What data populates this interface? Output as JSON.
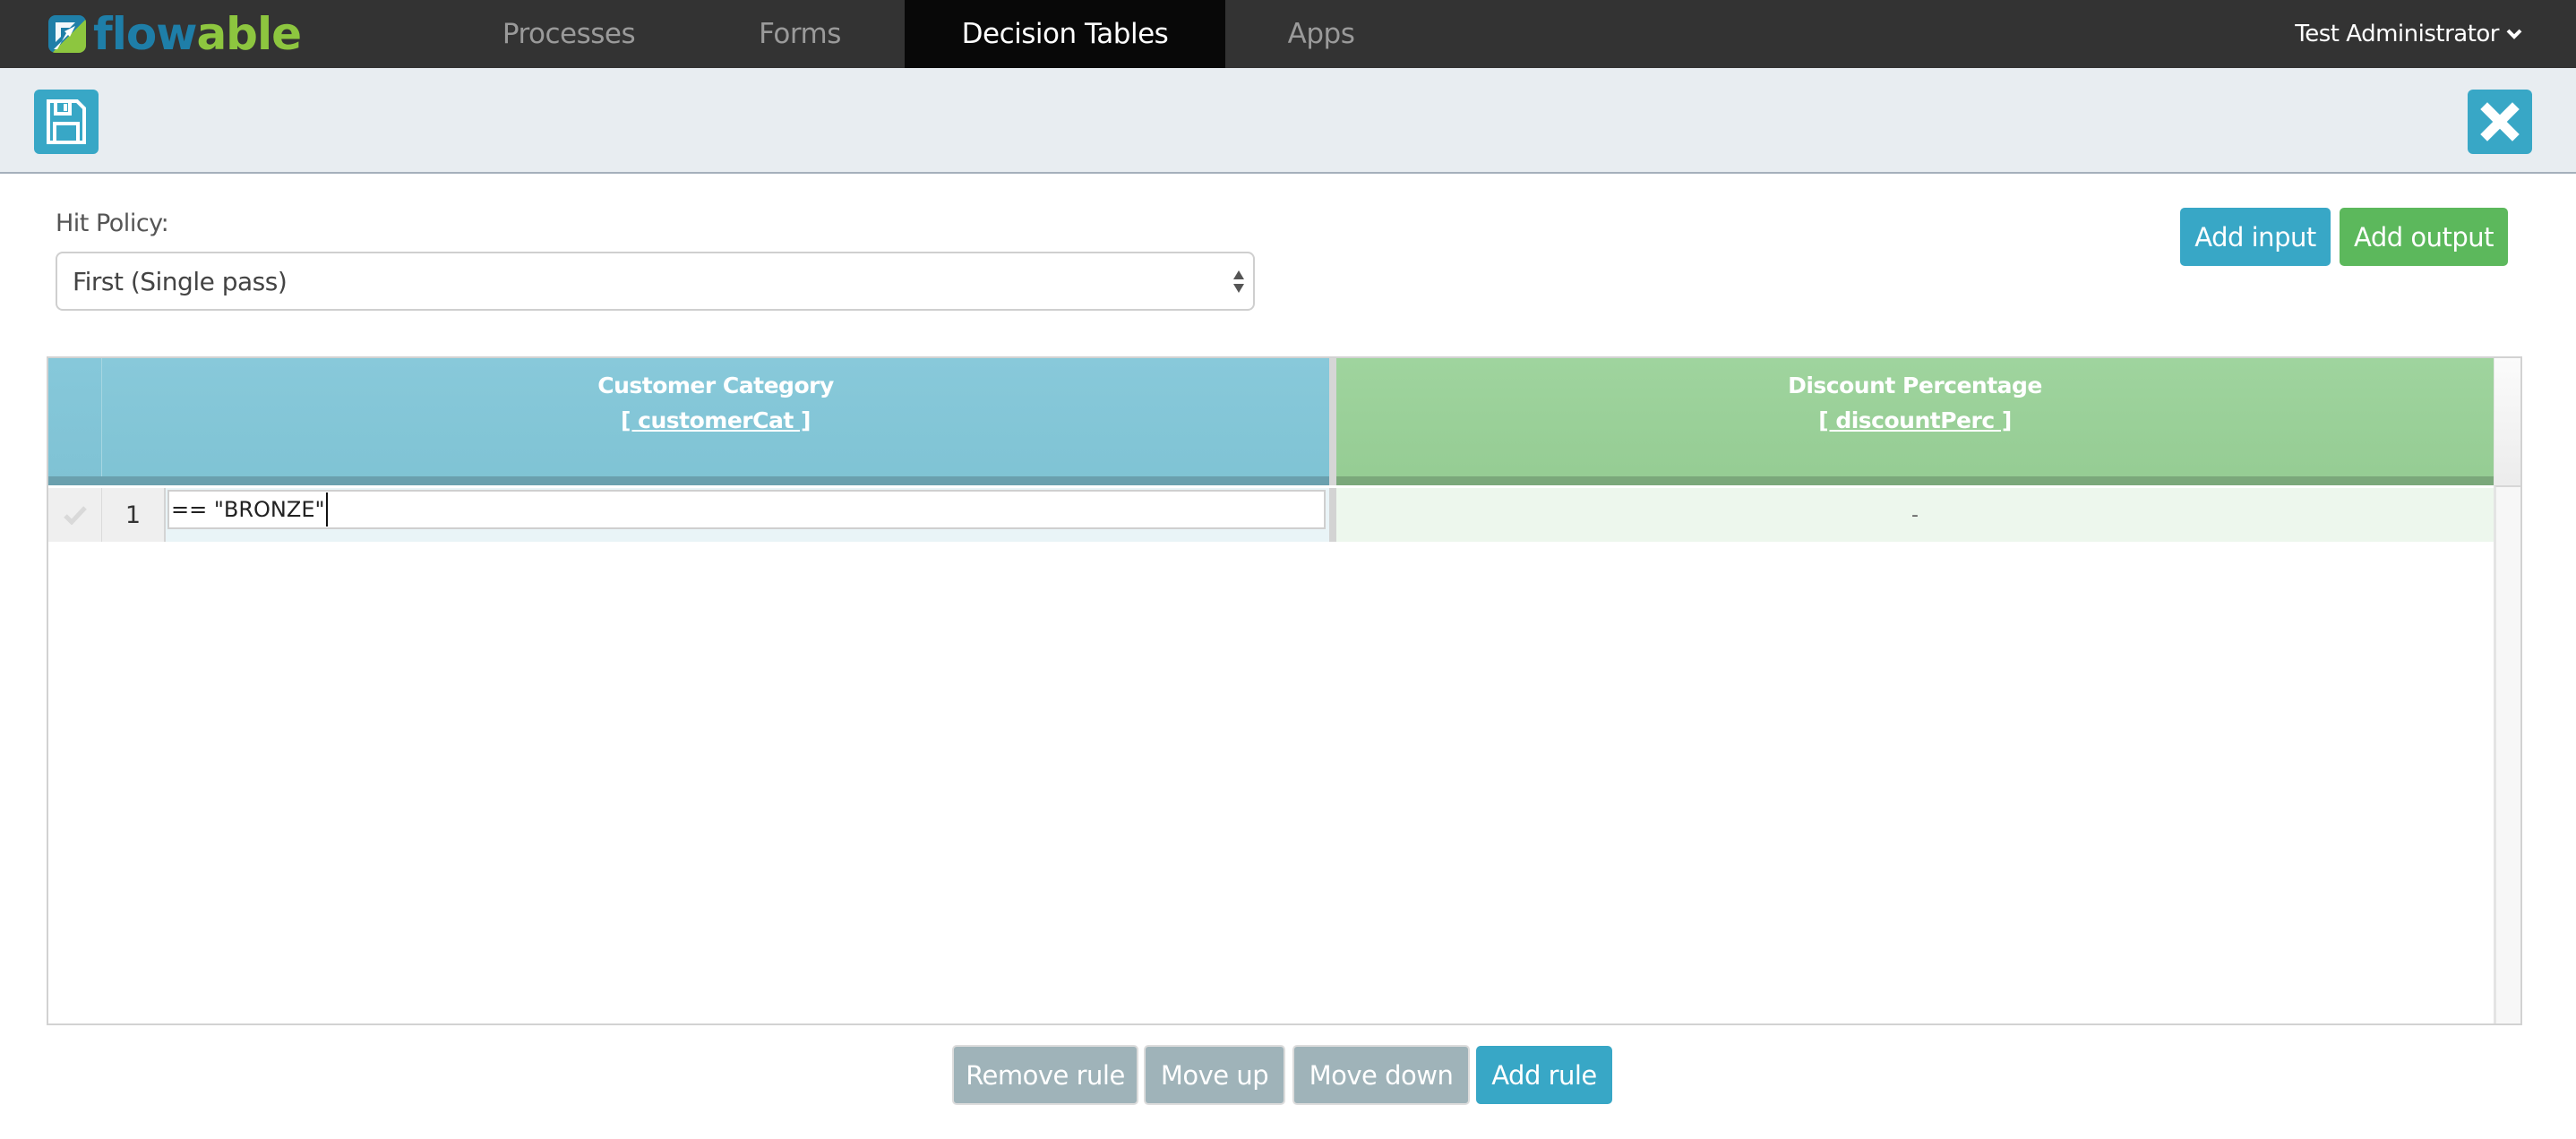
{
  "brand": {
    "logo_part1": "flow",
    "logo_part2": "able",
    "colors": {
      "blue": "#1e7ea8",
      "green": "#8dc63f"
    }
  },
  "nav": {
    "tabs": [
      {
        "label": "Processes",
        "active": false
      },
      {
        "label": "Forms",
        "active": false
      },
      {
        "label": "Decision Tables",
        "active": true
      },
      {
        "label": "Apps",
        "active": false
      }
    ],
    "user": {
      "name": "Test Administrator",
      "icon": "chevron-down-icon"
    }
  },
  "toolbar": {
    "save_icon": "save-icon",
    "close_icon": "close-icon"
  },
  "hit_policy": {
    "label": "Hit Policy:",
    "selected": "First (Single pass)"
  },
  "actions": {
    "add_input": "Add input",
    "add_output": "Add output"
  },
  "decision_table": {
    "input_columns": [
      {
        "label": "Customer Category",
        "variable": "[ customerCat ]"
      }
    ],
    "output_columns": [
      {
        "label": "Discount Percentage",
        "variable": "[ discountPerc ]"
      }
    ],
    "rules": [
      {
        "number": "1",
        "inputs": [
          "== \"BRONZE\""
        ],
        "outputs": [
          "-"
        ]
      }
    ]
  },
  "rule_actions": {
    "remove_rule": "Remove rule",
    "move_up": "Move up",
    "move_down": "Move down",
    "add_rule": "Add rule"
  },
  "colors": {
    "accent": "#38a7c6",
    "success": "#5cb85c",
    "disabled": "#9fb3b9",
    "input_header": "#84c6d8",
    "output_header": "#9bd199",
    "navbar": "#333333"
  }
}
